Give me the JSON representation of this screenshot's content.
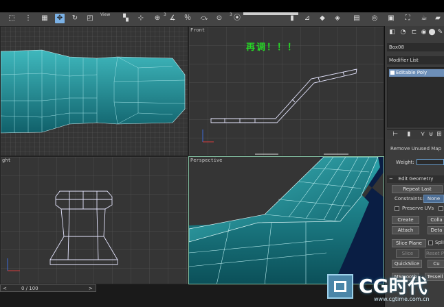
{
  "toolbar": {
    "tiny_labels": [
      "View",
      "3",
      "3"
    ]
  },
  "viewports": {
    "top": {
      "label": ""
    },
    "front": {
      "label": "Front"
    },
    "right": {
      "label": "ght"
    },
    "perspective": {
      "label": "Perspective"
    }
  },
  "annotation": {
    "text": "再调！！！"
  },
  "panel": {
    "object_name": "Box08",
    "modifier_list": "Modifier List",
    "stack_item": "Editable Poly",
    "truncated_rollout": "Remove Unused Map",
    "weight_label": "Weight:",
    "edit_geometry_title": "Edit Geometry",
    "repeat_last": "Repeat Last",
    "constraints_label": "Constraints:",
    "constraints_value": "None",
    "preserve_uvs": "Preserve UVs",
    "create": "Create",
    "collapse": "Colla",
    "attach": "Attach",
    "detach": "Deta",
    "slice_plane": "Slice Plane",
    "split": "Split",
    "slice": "Slice",
    "reset_plane": "Reset P",
    "quickslice": "QuickSlice",
    "cut": "Cu",
    "msmooth": "MSmooth",
    "tessellate": "Tessell"
  },
  "status": {
    "frame_counter": "0 / 100"
  },
  "watermark": {
    "brand": "CG时代",
    "url": "www.cgtime.com.cn"
  },
  "colors": {
    "mesh_teal": "#1f9aa3",
    "viewport_bg": "#353535",
    "active_border": "#86c4a5",
    "annotation_green": "#26d826",
    "selection_blue": "#6d8fb8"
  }
}
